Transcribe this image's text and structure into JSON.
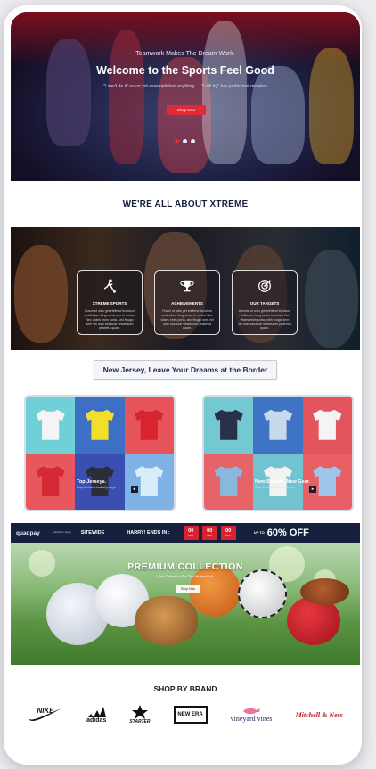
{
  "hero": {
    "tagline": "Teamwork Makes The Dream Work.",
    "title": "Welcome to the Sports Feel Good",
    "subtitle": "\"I can't do it\" never yet accomplished anything — \"I will try\" has performed miracles",
    "cta_label": "Shop Now",
    "slide_dots": 3,
    "active_slide": 1
  },
  "about": {
    "title": "WE'RE ALL ABOUT XTREME"
  },
  "features": [
    {
      "title": "XTREME SPORTS",
      "icon": "soccer-player-icon",
      "description": "Fusce ut odio get eleifend tincidunt vestibulum tring curas nec in metus. Nec vitaes enim porta, sed feugio sem vel odio lobulular vestibulum pharetra quam."
    },
    {
      "title": "ACHIEVEMENTS",
      "icon": "trophy-icon",
      "description": "Fusce ut odio get eleifend tincidunt vestibulum tring curas in metus. Nec vitaes enim porta, sed feugio sem vel odio lobulular vestibulum pharetra quam."
    },
    {
      "title": "OUR TARGETS",
      "icon": "target-icon",
      "description": "Aenean ut odio get eleifend tincidunt vestibulum tring curas in metus. Nec vitaes enim porta, nibh feugio sem vel odio lobulular vestibulum pharetra quam."
    }
  ],
  "jersey_banner": {
    "title": "New Jersey, Leave Your Dreams at the Border"
  },
  "jersey_panels": [
    {
      "caption": "Top Jerseys.",
      "caption_sub": "Shop the latest football jerseys",
      "tiles": [
        {
          "bg": "#6fd0d8",
          "shirt": "#f4f4f4"
        },
        {
          "bg": "#3d6fc5",
          "shirt": "#f3df2a"
        },
        {
          "bg": "#e6545a",
          "shirt": "#d8242e"
        },
        {
          "bg": "#e7585e",
          "shirt": "#d42a34"
        },
        {
          "bg": "#3b4fb3",
          "shirt": "#2a2d3a"
        },
        {
          "bg": "#7fb2e5",
          "shirt": "#d9ecfa"
        }
      ]
    },
    {
      "caption": "New Season, New Gear.",
      "caption_sub": "Shop the latest baseball jerseys",
      "tiles": [
        {
          "bg": "#74c8d2",
          "shirt": "#2a2f4a"
        },
        {
          "bg": "#3f73c4",
          "shirt": "#c7d9ec"
        },
        {
          "bg": "#e2555c",
          "shirt": "#f4f4f4"
        },
        {
          "bg": "#e66367",
          "shirt": "#89b7de"
        },
        {
          "bg": "#71c3d0",
          "shirt": "#f2f2f2"
        },
        {
          "bg": "#e85f65",
          "shirt": "#9fc6e8"
        }
      ]
    }
  ],
  "promo_banner": {
    "brand": "quadpay",
    "note": "Valuation apply",
    "sitewide": "SITEWIDE",
    "hurry": "HARRY! ENDS IN :",
    "countdown": [
      {
        "value": "00",
        "unit": "HRS"
      },
      {
        "value": "00",
        "unit": "MIN"
      },
      {
        "value": "00",
        "unit": "SEC"
      }
    ],
    "up_to": "UP TO",
    "discount": "60% OFF"
  },
  "premium": {
    "title": "PREMIUM  COLLECTION",
    "subtitle": "Our Collection For The Athlete Full",
    "cta_label": "Shop Now"
  },
  "brands": {
    "title": "SHOP BY BRAND",
    "items": [
      "NIKE",
      "adidas",
      "STARTER",
      "NEW ERA",
      "vineyard vines",
      "Mitchell & Ness"
    ]
  },
  "colors": {
    "accent": "#e22a36",
    "navy": "#17203d",
    "title": "#1a2140"
  }
}
